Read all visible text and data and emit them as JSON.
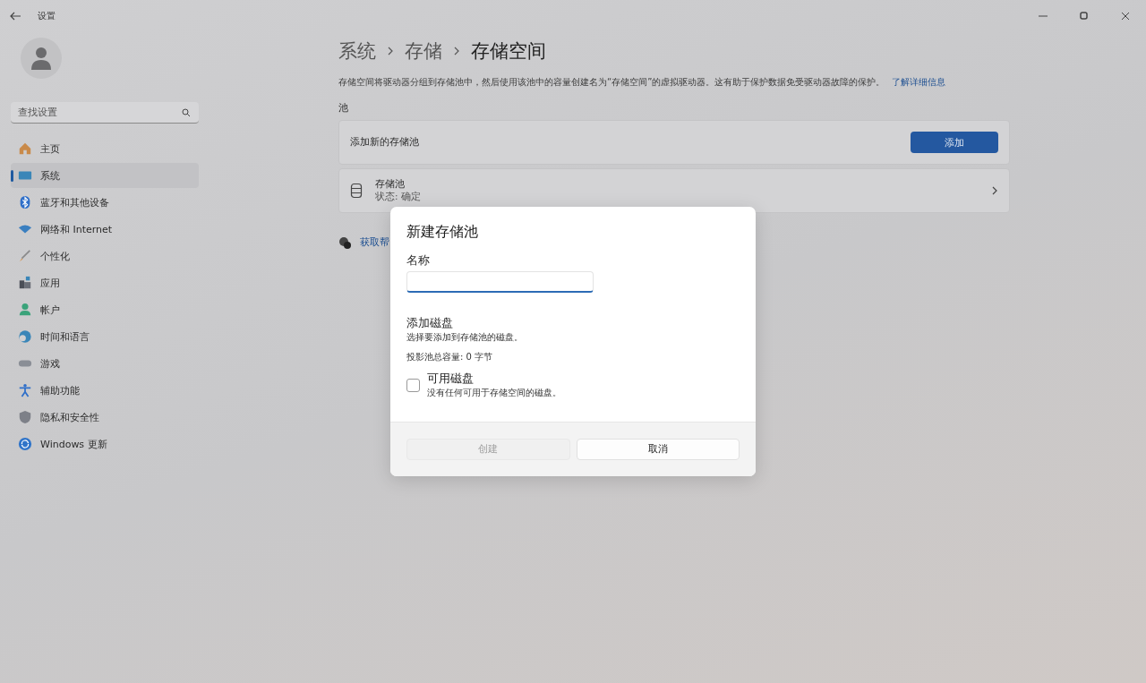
{
  "window": {
    "title": "设置"
  },
  "search": {
    "placeholder": "查找设置"
  },
  "sidebar": {
    "items": [
      {
        "label": "主页",
        "selected": false
      },
      {
        "label": "系统",
        "selected": true
      },
      {
        "label": "蓝牙和其他设备",
        "selected": false
      },
      {
        "label": "网络和 Internet",
        "selected": false
      },
      {
        "label": "个性化",
        "selected": false
      },
      {
        "label": "应用",
        "selected": false
      },
      {
        "label": "帐户",
        "selected": false
      },
      {
        "label": "时间和语言",
        "selected": false
      },
      {
        "label": "游戏",
        "selected": false
      },
      {
        "label": "辅助功能",
        "selected": false
      },
      {
        "label": "隐私和安全性",
        "selected": false
      },
      {
        "label": "Windows 更新",
        "selected": false
      }
    ]
  },
  "breadcrumb": [
    "系统",
    "存储",
    "存储空间"
  ],
  "description": "存储空间将驱动器分组到存储池中，然后使用该池中的容量创建名为“存储空间”的虚拟驱动器。这有助于保护数据免受驱动器故障的保护。",
  "learn_more": "了解详细信息",
  "section_title": "池",
  "add_pool": {
    "label": "添加新的存储池",
    "button": "添加"
  },
  "pool": {
    "title": "存储池",
    "subtitle": "状态: 确定"
  },
  "help_link": "获取帮",
  "dialog": {
    "title": "新建存储池",
    "name_label": "名称",
    "add_disks_title": "添加磁盘",
    "add_disks_hint": "选择要添加到存储池的磁盘。",
    "capacity": "投影池总容量: 0 字节",
    "available": {
      "label": "可用磁盘",
      "hint": "没有任何可用于存储空间的磁盘。",
      "checked": false
    },
    "buttons": [
      {
        "label": "创建",
        "disabled": true
      },
      {
        "label": "取消",
        "disabled": false
      }
    ]
  }
}
